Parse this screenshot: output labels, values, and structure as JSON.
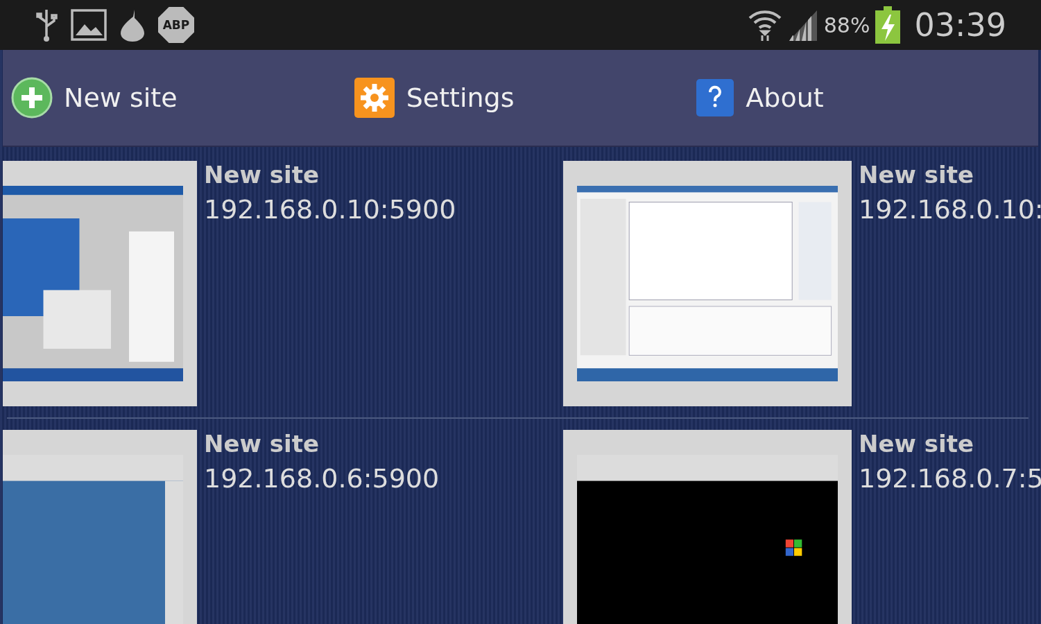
{
  "status_bar": {
    "abp_badge": "ABP",
    "battery": "88%",
    "time": "03:39"
  },
  "action_bar": [
    {
      "kind": "add",
      "label": "New site"
    },
    {
      "kind": "settings",
      "label": "Settings"
    },
    {
      "kind": "help",
      "label": "About"
    }
  ],
  "sites": [
    {
      "name": "New site",
      "address": "192.168.0.10:5900"
    },
    {
      "name": "New site",
      "address": "192.168.0.10:"
    },
    {
      "name": "New site",
      "address": "192.168.0.6:5900"
    },
    {
      "name": "New site",
      "address": "192.168.0.7:5"
    }
  ]
}
